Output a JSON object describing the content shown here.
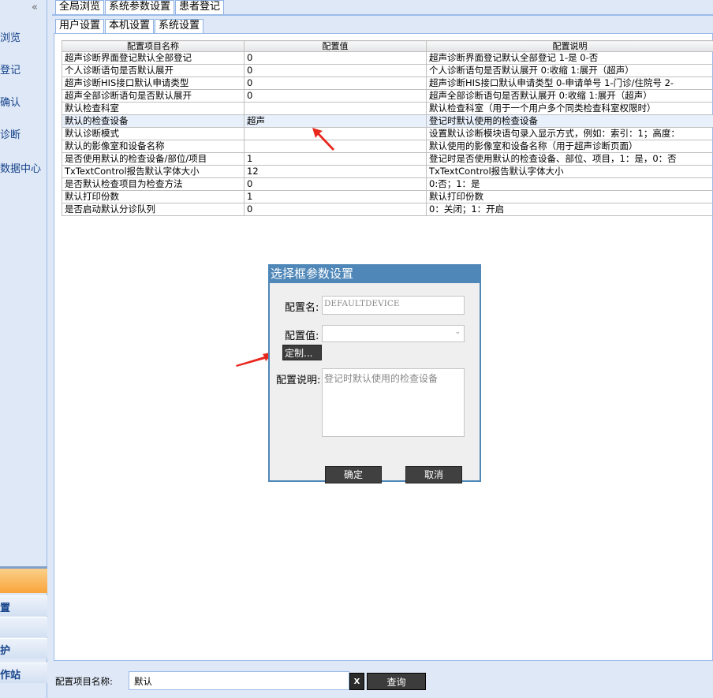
{
  "sidebar": {
    "collapse": "«",
    "items": [
      "浏览",
      "登记",
      "确认",
      "诊断",
      "数据中心"
    ],
    "bottom_items": [
      "置",
      "护",
      "作站"
    ]
  },
  "top_tabs": [
    "全局浏览",
    "系统参数设置",
    "患者登记"
  ],
  "sub_tabs": [
    "用户设置",
    "本机设置",
    "系统设置"
  ],
  "grid": {
    "headers": [
      "配置项目名称",
      "配置值",
      "配置说明"
    ],
    "rows": [
      {
        "name": "超声诊断界面登记默认全部登记",
        "value": "0",
        "desc": "超声诊断界面登记默认全部登记 1-是 0-否"
      },
      {
        "name": "个人诊断语句是否默认展开",
        "value": "0",
        "desc": "个人诊断语句是否默认展开 0:收缩 1:展开（超声）"
      },
      {
        "name": "超声诊断HIS接口默认申请类型",
        "value": "0",
        "desc": "超声诊断HIS接口默认申请类型 0-申请单号 1-门诊/住院号 2-"
      },
      {
        "name": "超声全部诊断语句是否默认展开",
        "value": "0",
        "desc": "超声全部诊断语句是否默认展开 0:收缩 1:展开（超声）"
      },
      {
        "name": "默认检查科室",
        "value": "",
        "desc": "默认检查科室（用于一个用户多个同类检查科室权限时）"
      },
      {
        "name": "默认的检查设备",
        "value": "超声",
        "desc": "登记时默认使用的检查设备"
      },
      {
        "name": "默认诊断模式",
        "value": "",
        "desc": "设置默认诊断模块语句录入显示方式，例如：索引：1；高度："
      },
      {
        "name": "默认的影像室和设备名称",
        "value": "",
        "desc": "默认使用的影像室和设备名称（用于超声诊断页面）"
      },
      {
        "name": "是否使用默认的检查设备/部位/项目",
        "value": "1",
        "desc": "登记时是否使用默认的检查设备、部位、项目，1：是，0：否"
      },
      {
        "name": "TxTextControl报告默认字体大小",
        "value": "12",
        "desc": "TxTextControl报告默认字体大小"
      },
      {
        "name": "是否默认检查项目为检查方法",
        "value": "0",
        "desc": "0:否；1：是"
      },
      {
        "name": "默认打印份数",
        "value": "1",
        "desc": "默认打印份数"
      },
      {
        "name": "是否启动默认分诊队列",
        "value": "0",
        "desc": "0：关闭；1：开启"
      }
    ]
  },
  "dialog": {
    "title": "选择框参数设置",
    "name_label": "配置名:",
    "name_value": "DEFAULTDEVICE",
    "value_label": "配置值:",
    "value_selected": "",
    "custom_button": "定制...",
    "desc_label": "配置说明:",
    "desc_value": "登记时默认使用的检查设备",
    "ok_button": "确定",
    "cancel_button": "取消"
  },
  "search": {
    "label": "配置项目名称:",
    "value": "默认",
    "clear_button": "X",
    "query_button": "查询"
  },
  "colors": {
    "dialog_accent": "#4f87b8",
    "arrow": "#e8271d",
    "sidebar_highlight": "#f9a43a"
  }
}
